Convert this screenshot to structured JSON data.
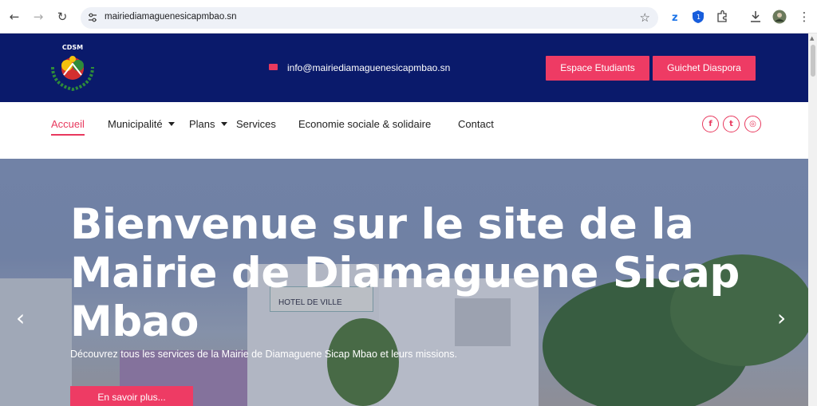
{
  "browser": {
    "url": "mairiediamaguenesicapmbao.sn",
    "back_icon": "arrow-left-icon",
    "forward_icon": "arrow-right-icon",
    "reload_icon": "reload-icon",
    "bookmark_icon": "star-icon"
  },
  "header": {
    "logo_text": "CDSM",
    "email": "info@mairiediamaguenesicapmbao.sn",
    "buttons": [
      "Espace Etudiants",
      "Guichet Diaspora"
    ]
  },
  "nav": {
    "items": [
      "Accueil",
      "Municipalité",
      "Plans",
      "Services",
      "Economie sociale & solidaire",
      "Contact"
    ],
    "social": [
      "facebook-icon",
      "twitter-icon",
      "instagram-icon"
    ]
  },
  "hero": {
    "title": "Bienvenue sur le site de la Mairie de Diamaguene Sicap Mbao",
    "subtitle": "Découvrez tous les services de la Mairie de Diamaguene Sicap Mbao et leurs missions.",
    "cta": "En savoir plus...",
    "sign": "HOTEL DE VILLE"
  },
  "colors": {
    "navy": "#0a1a6b",
    "accent": "#ee3b64"
  }
}
